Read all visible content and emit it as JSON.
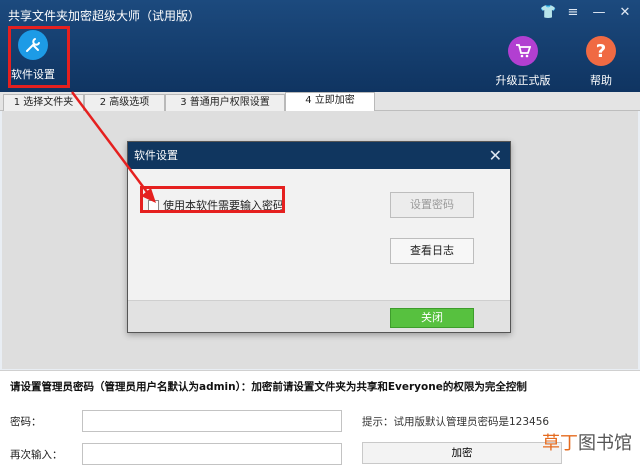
{
  "app": {
    "title": "共享文件夹加密超级大师（试用版）"
  },
  "toolbar": {
    "settings_label": "软件设置",
    "upgrade_label": "升级正式版",
    "help_label": "帮助"
  },
  "tabs": [
    {
      "label": "1 选择文件夹"
    },
    {
      "label": "2 高级选项"
    },
    {
      "label": "3 普通用户权限设置"
    },
    {
      "label": "4 立即加密"
    }
  ],
  "dialog": {
    "title": "软件设置",
    "checkbox_label": "使用本软件需要输入密码",
    "set_password_label": "设置密码",
    "view_log_label": "查看日志",
    "close_label": "关闭"
  },
  "form": {
    "notice": "请设置管理员密码（管理员用户名默认为admin）：加密前请设置文件夹为共享和Everyone的权限为完全控制",
    "password_label": "密码：",
    "confirm_label": "再次输入：",
    "password_value": "",
    "confirm_value": "",
    "hint": "提示：试用版默认管理员密码是123456",
    "encrypt_label": "加密"
  },
  "watermark": {
    "brand": "草丁",
    "rest": "图书馆"
  },
  "colors": {
    "header": "#10365f",
    "accent_red": "#e5201f",
    "close_green": "#57c13f"
  }
}
